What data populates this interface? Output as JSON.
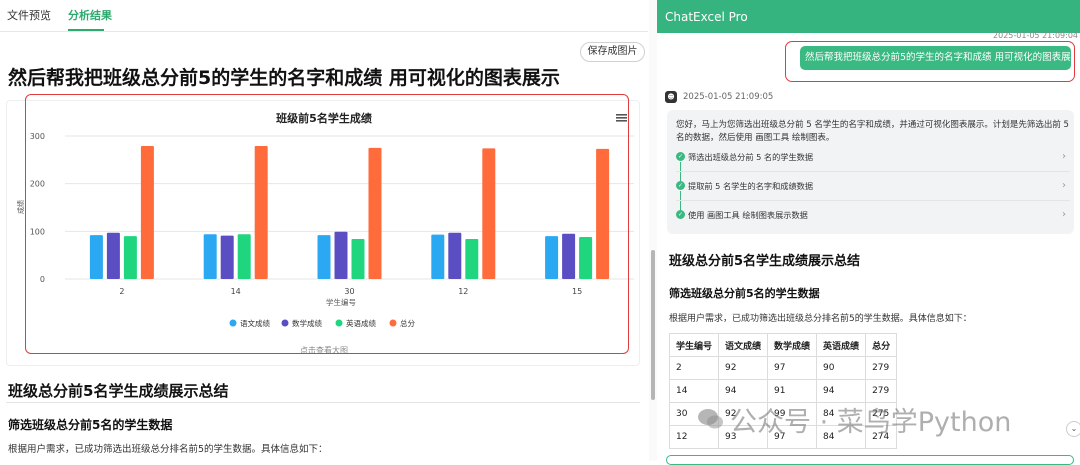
{
  "tabs": [
    {
      "label": "文件预览"
    },
    {
      "label": "分析结果"
    }
  ],
  "toolbar": {
    "save_label": "保存成图片"
  },
  "page_title": "然后帮我把班级总分前5的学生的名字和成绩 用可视化的图表展示",
  "chart_footer": "点击查看大图",
  "chart_data": {
    "type": "bar",
    "title": "班级前5名学生成绩",
    "xlabel": "学生编号",
    "ylabel": "成绩",
    "categories": [
      "2",
      "14",
      "30",
      "12",
      "15"
    ],
    "ylim": [
      0,
      300
    ],
    "yticks": [
      0,
      100,
      200,
      300
    ],
    "legend_position": "bottom",
    "series": [
      {
        "name": "语文成绩",
        "color": "#2aa8f2",
        "values": [
          92,
          94,
          92,
          93,
          90
        ]
      },
      {
        "name": "数学成绩",
        "color": "#5b4dc2",
        "values": [
          97,
          91,
          99,
          97,
          95
        ]
      },
      {
        "name": "英语成绩",
        "color": "#1fd67e",
        "values": [
          90,
          94,
          84,
          84,
          88
        ]
      },
      {
        "name": "总分",
        "color": "#ff6b3b",
        "values": [
          279,
          279,
          275,
          274,
          273
        ]
      }
    ]
  },
  "summary": {
    "h1": "班级总分前5名学生成绩展示总结",
    "h2": "筛选班级总分前5名的学生数据",
    "para": "根据用户需求，已成功筛选出班级总分排名前5的学生数据。具体信息如下："
  },
  "chat": {
    "app_title": "ChatExcel Pro",
    "user_time": "2025-01-05 21:09:04",
    "user_message": "然后帮我把班级总分前5的学生的名字和成绩 用可视化的图表展示",
    "bot_time": "2025-01-05 21:09:05",
    "bot_intro": "您好，马上为您筛选出班级总分前 5 名学生的名字和成绩，并通过可视化图表展示。计划是先筛选出前 5 名的数据，然后使用 画图工具 绘制图表。",
    "steps": [
      {
        "label": "筛选出班级总分前 5 名的学生数据"
      },
      {
        "label": "提取前 5 名学生的名字和成绩数据"
      },
      {
        "label": "使用 画图工具 绘制图表展示数据"
      }
    ],
    "h1": "班级总分前5名学生成绩展示总结",
    "h2": "筛选班级总分前5名的学生数据",
    "para": "根据用户需求，已成功筛选出班级总分排名前5的学生数据。具体信息如下：",
    "table_headers": [
      "学生编号",
      "语文成绩",
      "数学成绩",
      "英语成绩",
      "总分"
    ],
    "table_rows": [
      [
        "2",
        "92",
        "97",
        "90",
        "279"
      ],
      [
        "14",
        "94",
        "91",
        "94",
        "279"
      ],
      [
        "30",
        "92",
        "99",
        "84",
        "275"
      ],
      [
        "12",
        "93",
        "97",
        "84",
        "274"
      ]
    ]
  },
  "watermark": "公众号 · 菜鸟学Python"
}
